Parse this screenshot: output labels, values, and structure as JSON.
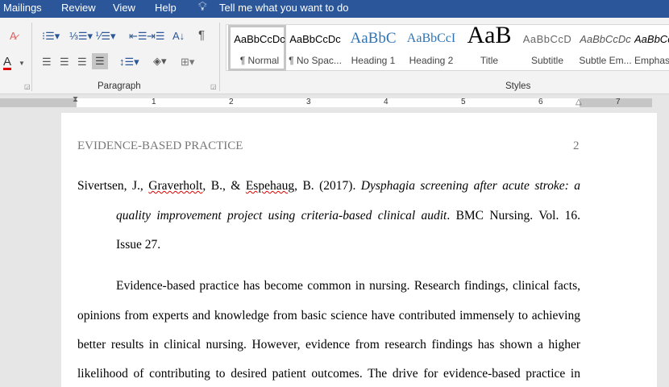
{
  "menu": {
    "items": [
      "Mailings",
      "Review",
      "View",
      "Help"
    ],
    "tell_me": "Tell me what you want to do"
  },
  "ribbon": {
    "paragraph_label": "Paragraph",
    "styles_label": "Styles",
    "styles": [
      {
        "preview": "AaBbCcDc",
        "label": "¶ Normal"
      },
      {
        "preview": "AaBbCcDc",
        "label": "¶ No Spac..."
      },
      {
        "preview": "AaBbC",
        "label": "Heading 1"
      },
      {
        "preview": "AaBbCcI",
        "label": "Heading 2"
      },
      {
        "preview": "AaB",
        "label": "Title"
      },
      {
        "preview": "AaBbCcD",
        "label": "Subtitle"
      },
      {
        "preview": "AaBbCcDc",
        "label": "Subtle Em..."
      },
      {
        "preview": "AaBbCcDc",
        "label": "Emphasis"
      }
    ]
  },
  "ruler": {
    "numbers": [
      "1",
      "2",
      "3",
      "4",
      "5",
      "6",
      "7"
    ]
  },
  "document": {
    "header_title": "EVIDENCE-BASED PRACTICE",
    "page_number": "2",
    "ref": {
      "authors_a": "Sivertsen, J., ",
      "author_b": "Graverholt",
      "mid": ", B., & ",
      "author_c": "Espehaug",
      "end": ", B. (2017). ",
      "title_1": "Dysphagia screening after acute stroke: a",
      "title_2": "quality improvement project using criteria-based clinical audit",
      "rest_2": ". BMC Nursing. Vol. 16.",
      "line_3": "Issue 27."
    },
    "para_lines": [
      "Evidence-based practice has become common in nursing. Research findings, clinical facts,",
      "opinions from experts and knowledge from basic science have contributed immensely to achieving",
      "better results in clinical nursing. However, evidence from research findings has shown a higher",
      "likelihood of contributing to desired patient outcomes. The drive for evidence-based practice in"
    ]
  }
}
